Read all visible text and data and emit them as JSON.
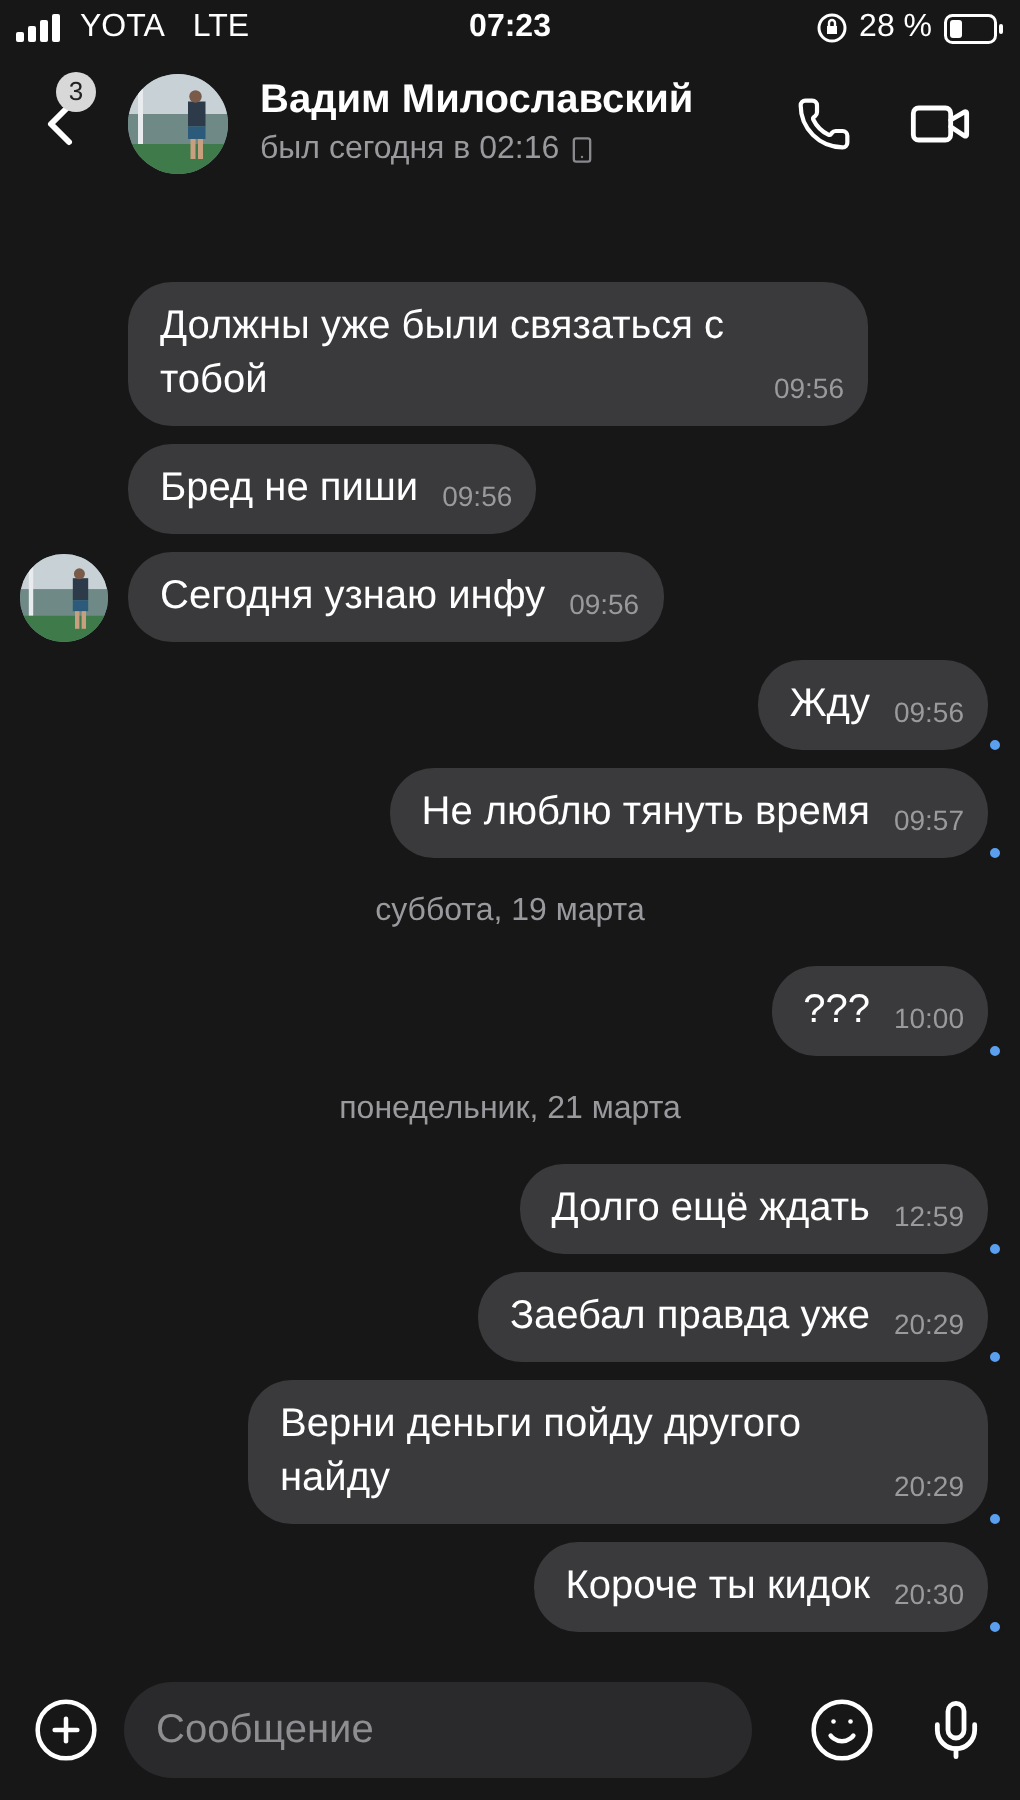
{
  "status_bar": {
    "carrier": "YOTA",
    "network": "LTE",
    "time": "07:23",
    "battery": "28 %"
  },
  "header": {
    "back_badge": "3",
    "name": "Вадим Милославский",
    "last_seen": "был сегодня в 02:16"
  },
  "messages": [
    {
      "kind": "incoming",
      "text": "Должны уже были связаться с тобой",
      "time": "09:56",
      "avatar": false
    },
    {
      "kind": "incoming",
      "text": "Бред не пиши",
      "time": "09:56",
      "avatar": false
    },
    {
      "kind": "incoming",
      "text": "Сегодня узнаю инфу",
      "time": "09:56",
      "avatar": true
    },
    {
      "kind": "outgoing",
      "text": "Жду",
      "time": "09:56",
      "unread": true
    },
    {
      "kind": "outgoing",
      "text": "Не люблю тянуть время",
      "time": "09:57",
      "unread": true
    },
    {
      "kind": "date",
      "text": "суббота, 19 марта"
    },
    {
      "kind": "outgoing",
      "text": "???",
      "time": "10:00",
      "unread": true
    },
    {
      "kind": "date",
      "text": "понедельник, 21 марта"
    },
    {
      "kind": "outgoing",
      "text": "Долго  ещё ждать",
      "time": "12:59",
      "unread": true
    },
    {
      "kind": "outgoing",
      "text": "Заебал правда уже",
      "time": "20:29",
      "unread": true
    },
    {
      "kind": "outgoing",
      "text": "Верни деньги пойду другого найду",
      "time": "20:29",
      "unread": true
    },
    {
      "kind": "outgoing",
      "text": "Короче ты кидок",
      "time": "20:30",
      "unread": true
    }
  ],
  "composer": {
    "placeholder": "Сообщение"
  }
}
